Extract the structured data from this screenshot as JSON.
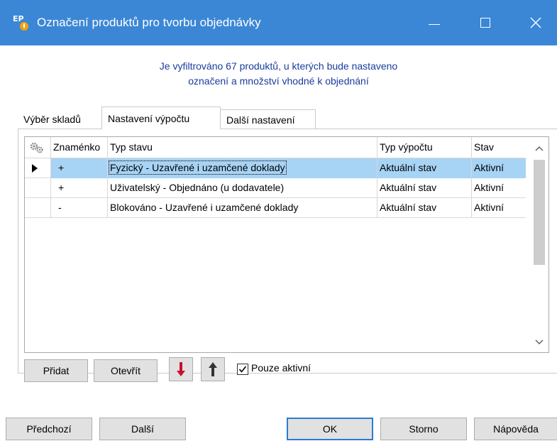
{
  "window": {
    "app_icon_text": "EP",
    "title": "Označení produktů pro tvorbu objednávky"
  },
  "info": {
    "line1": "Je vyfiltrováno 67 produktů, u kterých bude nastaveno",
    "line2": "označení a množství vhodné k objednání"
  },
  "tabs": [
    {
      "label": "Výběr skladů"
    },
    {
      "label": "Nastavení výpočtu",
      "active": true
    },
    {
      "label": "Další nastavení"
    }
  ],
  "grid": {
    "headers": {
      "sign": "Znaménko",
      "type": "Typ stavu",
      "calc": "Typ výpočtu",
      "stav": "Stav"
    },
    "rows": [
      {
        "sign": "+",
        "type": "Fyzický - Uzavřené i uzamčené doklady",
        "calc": "Aktuální stav",
        "stav": "Aktivní",
        "selected": true
      },
      {
        "sign": "+",
        "type": "Uživatelský - Objednáno (u dodavatele)",
        "calc": "Aktuální stav",
        "stav": "Aktivní"
      },
      {
        "sign": "-",
        "type": "Blokováno - Uzavřené i uzamčené doklady",
        "calc": "Aktuální stav",
        "stav": "Aktivní"
      }
    ]
  },
  "toolbar": {
    "add_label": "Přidat",
    "open_label": "Otevřít",
    "only_active_label": "Pouze aktivní",
    "only_active_checked": true
  },
  "footer": {
    "prev_label": "Předchozí",
    "next_label": "Další",
    "ok_label": "OK",
    "cancel_label": "Storno",
    "help_label": "Nápověda"
  },
  "colors": {
    "titlebar": "#3b87d6",
    "info_text": "#1a3d9c",
    "selection": "#a7d3f5",
    "arrow_down": "#c8102e",
    "arrow_up": "#333333"
  }
}
